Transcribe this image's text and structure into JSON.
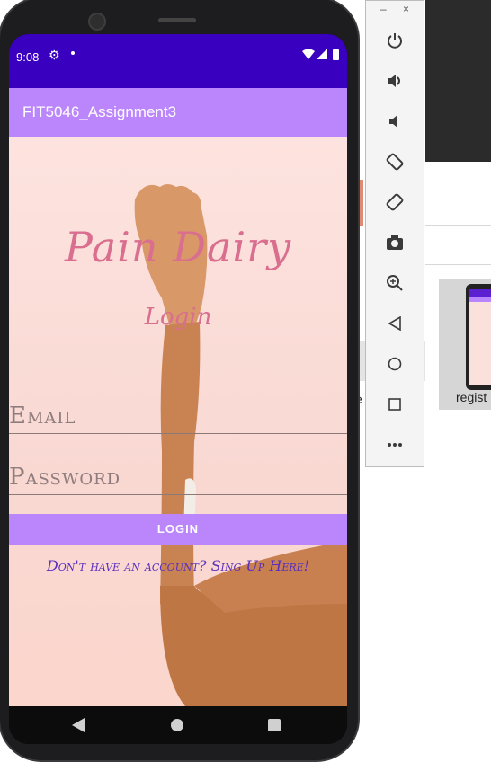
{
  "app": {
    "title": "FIT5046_Assignment3",
    "status_time": "9:08"
  },
  "login_screen": {
    "heading": "Pain Dairy",
    "subheading": "Login",
    "email_placeholder": "Email",
    "password_placeholder": "Password",
    "login_button": "LOGIN",
    "signup_link": "Don't have an account? Sing Up Here!"
  },
  "emulator_toolbar": {
    "minimize": "–",
    "close": "×",
    "icons": [
      "power-icon",
      "volume-up-icon",
      "volume-down-icon",
      "rotate-left-icon",
      "rotate-right-icon",
      "camera-icon",
      "zoom-icon",
      "back-icon",
      "home-icon",
      "overview-icon",
      "more-icon"
    ]
  },
  "desktop": {
    "thumbnail_label": "regist",
    "fragment_text": "e"
  },
  "colors": {
    "status_bar": "#3a00c0",
    "app_bar": "#bb86fc",
    "accent_text": "#5a2fbf",
    "title_pink": "#d96e8f"
  }
}
